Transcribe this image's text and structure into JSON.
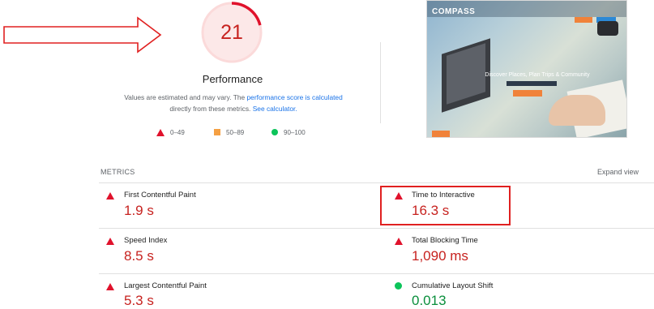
{
  "gauge": {
    "score": "21",
    "score_fraction": 0.21,
    "title": "Performance",
    "color": "#c7221f"
  },
  "description": {
    "text_before": "Values are estimated and may vary. The ",
    "link1": "performance score is calculated",
    "text_middle": " directly from these metrics. ",
    "link2": "See calculator."
  },
  "legend": [
    {
      "icon": "red-triangle-icon",
      "label": "0–49",
      "color": "#e0122c"
    },
    {
      "icon": "orange-square-icon",
      "label": "50–89",
      "color": "#f5a043"
    },
    {
      "icon": "green-circle-icon",
      "label": "90–100",
      "color": "#0cc45a"
    }
  ],
  "thumbnail": {
    "logo": "COMPASS",
    "hero_text": "Discover Places, Plan Trips & Community"
  },
  "metrics": {
    "header": "METRICS",
    "expand": "Expand view",
    "items": [
      {
        "name": "First Contentful Paint",
        "value": "1.9 s",
        "status": "fail"
      },
      {
        "name": "Time to Interactive",
        "value": "16.3 s",
        "status": "fail"
      },
      {
        "name": "Speed Index",
        "value": "8.5 s",
        "status": "fail"
      },
      {
        "name": "Total Blocking Time",
        "value": "1,090 ms",
        "status": "fail"
      },
      {
        "name": "Largest Contentful Paint",
        "value": "5.3 s",
        "status": "fail"
      },
      {
        "name": "Cumulative Layout Shift",
        "value": "0.013",
        "status": "pass"
      }
    ]
  },
  "colors": {
    "fail": "#c7221f",
    "pass": "#0a8f3c",
    "link": "#1a73e8",
    "annotation": "#e02020"
  }
}
